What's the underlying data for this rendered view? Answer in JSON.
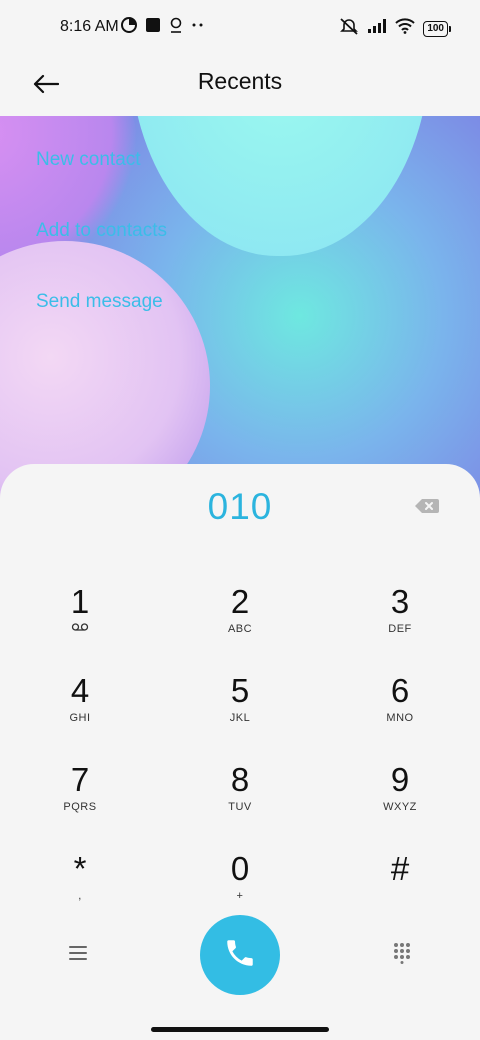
{
  "status_bar": {
    "time": "8:16 AM",
    "left_icons": [
      "data-saver-icon",
      "app-square-icon",
      "location-pin-icon",
      "more-dots-icon"
    ],
    "right_icons": [
      "mute-icon",
      "signal-icon",
      "wifi-icon"
    ],
    "battery": "100"
  },
  "header": {
    "title": "Recents",
    "back_icon": "back-arrow-icon"
  },
  "actions": {
    "new_contact": "New contact",
    "add_to_contacts": "Add to contacts",
    "send_message": "Send message"
  },
  "dialpad": {
    "number": "010",
    "backspace_icon": "backspace-icon",
    "keys": [
      {
        "digit": "1",
        "letters": ""
      },
      {
        "digit": "2",
        "letters": "ABC"
      },
      {
        "digit": "3",
        "letters": "DEF"
      },
      {
        "digit": "4",
        "letters": "GHI"
      },
      {
        "digit": "5",
        "letters": "JKL"
      },
      {
        "digit": "6",
        "letters": "MNO"
      },
      {
        "digit": "7",
        "letters": "PQRS"
      },
      {
        "digit": "8",
        "letters": "TUV"
      },
      {
        "digit": "9",
        "letters": "WXYZ"
      },
      {
        "digit": "*",
        "letters": ","
      },
      {
        "digit": "0",
        "letters": "+"
      },
      {
        "digit": "#",
        "letters": ""
      }
    ]
  },
  "bottom_bar": {
    "menu_icon": "menu-icon",
    "call_icon": "phone-call-icon",
    "keypad_icon": "dialpad-grid-icon"
  },
  "colors": {
    "accent": "#2bb4de",
    "call_button": "#33bde4",
    "background": "#f5f5f5",
    "text": "#111111"
  }
}
